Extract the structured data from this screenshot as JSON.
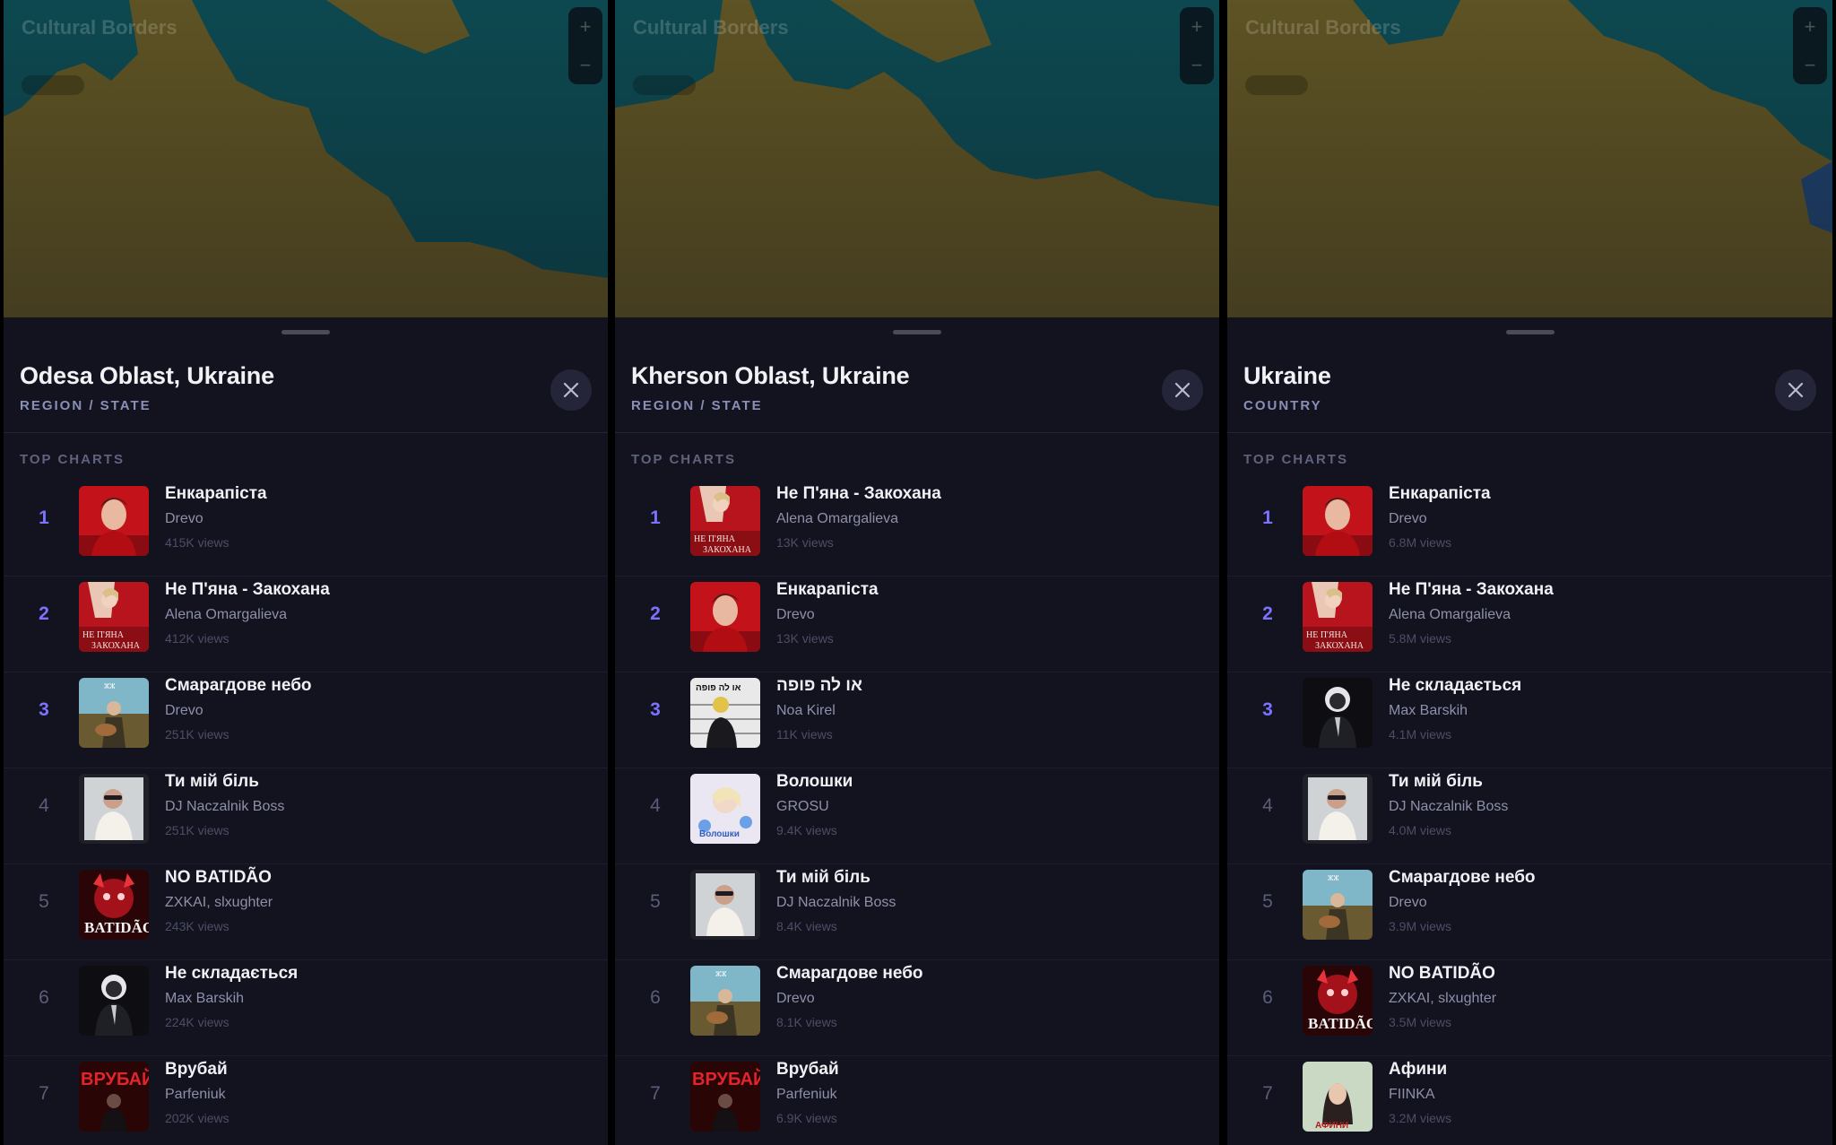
{
  "map_overlay": {
    "title": "Cultural Borders",
    "zoom_in": "+",
    "zoom_out": "−",
    "colors": {
      "teal": "#0f6b70",
      "gold": "#8f7a2a"
    }
  },
  "section_label": "TOP CHARTS",
  "close_symbol": "✕",
  "panels": [
    {
      "location": "Odesa Oblast, Ukraine",
      "type": "REGION / STATE",
      "rows": [
        {
          "rank": "1",
          "title": "Енкарапіста",
          "artist": "Drevo",
          "views": "415K views",
          "art": "red-portrait"
        },
        {
          "rank": "2",
          "title": "Не П'яна - Закохана",
          "artist": "Alena Omargalieva",
          "views": "412K views",
          "art": "red-cover"
        },
        {
          "rank": "3",
          "title": "Смарагдове небо",
          "artist": "Drevo",
          "views": "251K views",
          "art": "sky-guitar"
        },
        {
          "rank": "4",
          "title": "Ти мій біль",
          "artist": "DJ Naczalnik Boss",
          "views": "251K views",
          "art": "photo-man"
        },
        {
          "rank": "5",
          "title": "NO BATIDÃO",
          "artist": "ZXKAI, slxughter",
          "views": "243K views",
          "art": "red-demon"
        },
        {
          "rank": "6",
          "title": "Не складається",
          "artist": "Max Barskih",
          "views": "224K views",
          "art": "dark-suit"
        },
        {
          "rank": "7",
          "title": "Врубай",
          "artist": "Parfeniuk",
          "views": "202K views",
          "art": "vrubai"
        }
      ]
    },
    {
      "location": "Kherson Oblast, Ukraine",
      "type": "REGION / STATE",
      "rows": [
        {
          "rank": "1",
          "title": "Не П'яна - Закохана",
          "artist": "Alena Omargalieva",
          "views": "13K views",
          "art": "red-cover"
        },
        {
          "rank": "2",
          "title": "Енкарапіста",
          "artist": "Drevo",
          "views": "13K views",
          "art": "red-portrait"
        },
        {
          "rank": "3",
          "title": "או לה פופה",
          "artist": "Noa Kirel",
          "views": "11K views",
          "art": "lineup"
        },
        {
          "rank": "4",
          "title": "Волошки",
          "artist": "GROSU",
          "views": "9.4K views",
          "art": "voloshki"
        },
        {
          "rank": "5",
          "title": "Ти мій біль",
          "artist": "DJ Naczalnik Boss",
          "views": "8.4K views",
          "art": "photo-man"
        },
        {
          "rank": "6",
          "title": "Смарагдове небо",
          "artist": "Drevo",
          "views": "8.1K views",
          "art": "sky-guitar"
        },
        {
          "rank": "7",
          "title": "Врубай",
          "artist": "Parfeniuk",
          "views": "6.9K views",
          "art": "vrubai"
        }
      ]
    },
    {
      "location": "Ukraine",
      "type": "COUNTRY",
      "rows": [
        {
          "rank": "1",
          "title": "Енкарапіста",
          "artist": "Drevo",
          "views": "6.8M views",
          "art": "red-portrait"
        },
        {
          "rank": "2",
          "title": "Не П'яна - Закохана",
          "artist": "Alena Omargalieva",
          "views": "5.8M views",
          "art": "red-cover"
        },
        {
          "rank": "3",
          "title": "Не складається",
          "artist": "Max Barskih",
          "views": "4.1M views",
          "art": "dark-suit"
        },
        {
          "rank": "4",
          "title": "Ти мій біль",
          "artist": "DJ Naczalnik Boss",
          "views": "4.0M views",
          "art": "photo-man"
        },
        {
          "rank": "5",
          "title": "Смарагдове небо",
          "artist": "Drevo",
          "views": "3.9M views",
          "art": "sky-guitar"
        },
        {
          "rank": "6",
          "title": "NO BATIDÃO",
          "artist": "ZXKAI, slxughter",
          "views": "3.5M views",
          "art": "red-demon"
        },
        {
          "rank": "7",
          "title": "Афини",
          "artist": "FIINKA",
          "views": "3.2M views",
          "art": "afiny"
        }
      ]
    }
  ]
}
